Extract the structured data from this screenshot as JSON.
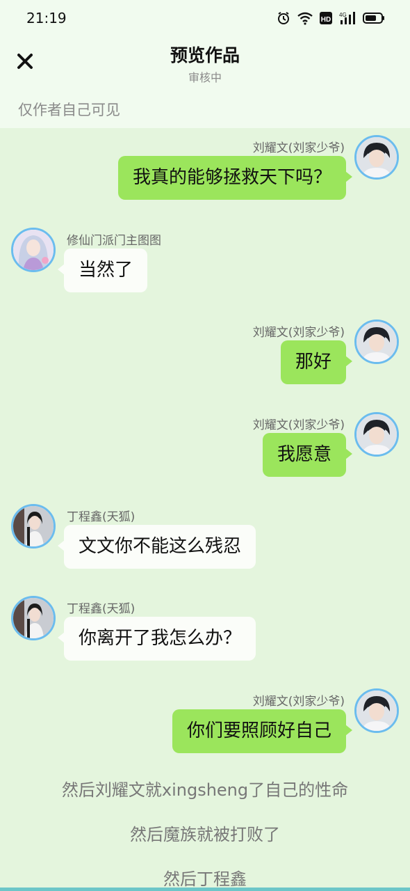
{
  "status": {
    "time": "21:19",
    "network": "4G"
  },
  "header": {
    "title": "预览作品",
    "subtitle": "审核中",
    "close_icon": "close-icon"
  },
  "visibility_note": "仅作者自己可见",
  "colors": {
    "background": "#e4f5dd",
    "header_background": "#f1fbef",
    "bubble_right": "#9be55c",
    "bubble_left": "#fbfdf9",
    "avatar_border": "#6bbcee"
  },
  "messages": [
    {
      "side": "right",
      "speaker": "刘耀文(刘家少爷)",
      "text": "我真的能够拯救天下吗？"
    },
    {
      "side": "left",
      "speaker": "修仙门派门主图图",
      "text": "当然了"
    },
    {
      "side": "right",
      "speaker": "刘耀文(刘家少爷)",
      "text": "那好"
    },
    {
      "side": "right",
      "speaker": "刘耀文(刘家少爷)",
      "text": "我愿意"
    },
    {
      "side": "left",
      "speaker": "丁程鑫(天狐)",
      "text": "文文你不能这么残忍"
    },
    {
      "side": "left",
      "speaker": "丁程鑫(天狐)",
      "text": "你离开了我怎么办？"
    },
    {
      "side": "right",
      "speaker": "刘耀文(刘家少爷)",
      "text": "你们要照顾好自己"
    }
  ],
  "narrations": [
    "然后刘耀文就xingsheng了自己的性命",
    "然后魔族就被打败了",
    "然后丁程鑫"
  ]
}
